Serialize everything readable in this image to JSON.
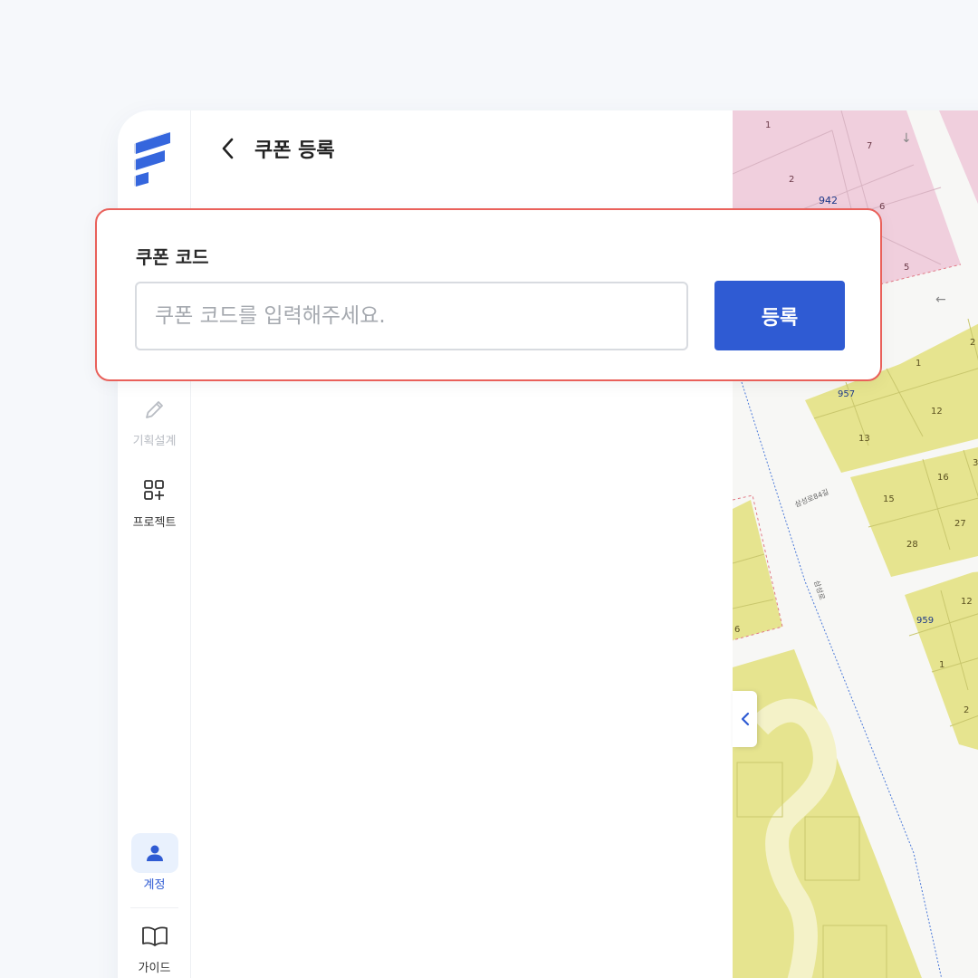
{
  "sidebar": {
    "items": [
      {
        "label": "기획설계",
        "icon": "pencil-icon",
        "state": "disabled"
      },
      {
        "label": "프로젝트",
        "icon": "grid-plus-icon",
        "state": "normal"
      },
      {
        "label": "계정",
        "icon": "user-icon",
        "state": "active"
      },
      {
        "label": "가이드",
        "icon": "book-icon",
        "state": "normal"
      }
    ]
  },
  "panel": {
    "title": "쿠폰 등록"
  },
  "coupon": {
    "label": "쿠폰 코드",
    "input_value": "",
    "placeholder": "쿠폰 코드를 입력해주세요.",
    "button_label": "등록"
  },
  "map": {
    "parcel_labels": [
      "1",
      "7",
      "2",
      "942",
      "6",
      "5",
      "2",
      "1",
      "957",
      "12",
      "13",
      "3",
      "16",
      "15",
      "27",
      "28",
      "12",
      "959",
      "1",
      "2",
      "6"
    ],
    "road_labels": [
      "삼성로84길",
      "삼성로"
    ]
  },
  "colors": {
    "accent": "#2f5bd3",
    "card_border": "#e9605a",
    "zone_pink": "#f0cfdd",
    "zone_yellow": "#e6e48f",
    "active_bg": "#e9f1fd"
  }
}
